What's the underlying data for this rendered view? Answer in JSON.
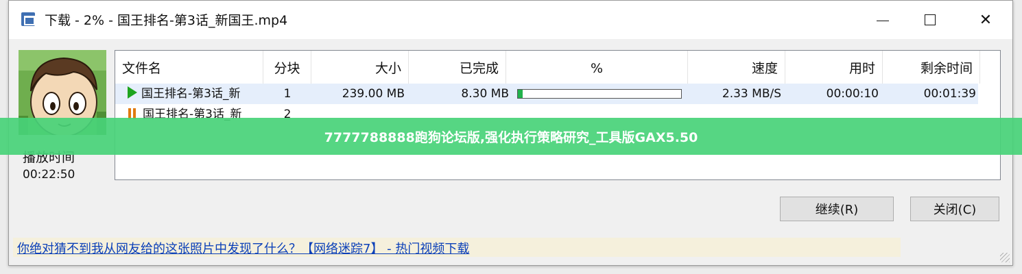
{
  "window": {
    "title": "下载 - 2% - 国王排名-第3话_新国王.mp4",
    "app_icon": "download-app-icon",
    "controls": {
      "minimize": "minimize-icon",
      "maximize": "maximize-icon",
      "close": "✕"
    }
  },
  "preview": {
    "play_label": "播放时间",
    "play_time": "00:22:50"
  },
  "list": {
    "columns": [
      "文件名",
      "分块",
      "大小",
      "已完成",
      "%",
      "速度",
      "用时",
      "剩余时间"
    ],
    "rows": [
      {
        "status_icon": "play-icon",
        "name": "国王排名-第3话_新",
        "chunk": "1",
        "size": "239.00 MB",
        "done": "8.30 MB",
        "progress": 0.03,
        "speed": "2.33 MB/S",
        "elapsed": "00:00:10",
        "remaining": "00:01:39"
      },
      {
        "status_icon": "pause-icon",
        "name": "国王排名-第3话_新",
        "chunk": "2",
        "size": "",
        "done": "",
        "progress": null,
        "speed": "",
        "elapsed": "",
        "remaining": ""
      }
    ],
    "progress_color": "#22b24c"
  },
  "buttons": {
    "continue": "继续(R)",
    "close": "关闭(C)"
  },
  "ad": {
    "text": "你绝对猜不到我从网友给的这张照片中发现了什么？【网络迷踪7】 - 热门视频下载"
  },
  "overlay_banner": {
    "text": "7777788888跑狗论坛版,强化执行策略研究_工具版GAX5.50",
    "color": "#48d278"
  }
}
